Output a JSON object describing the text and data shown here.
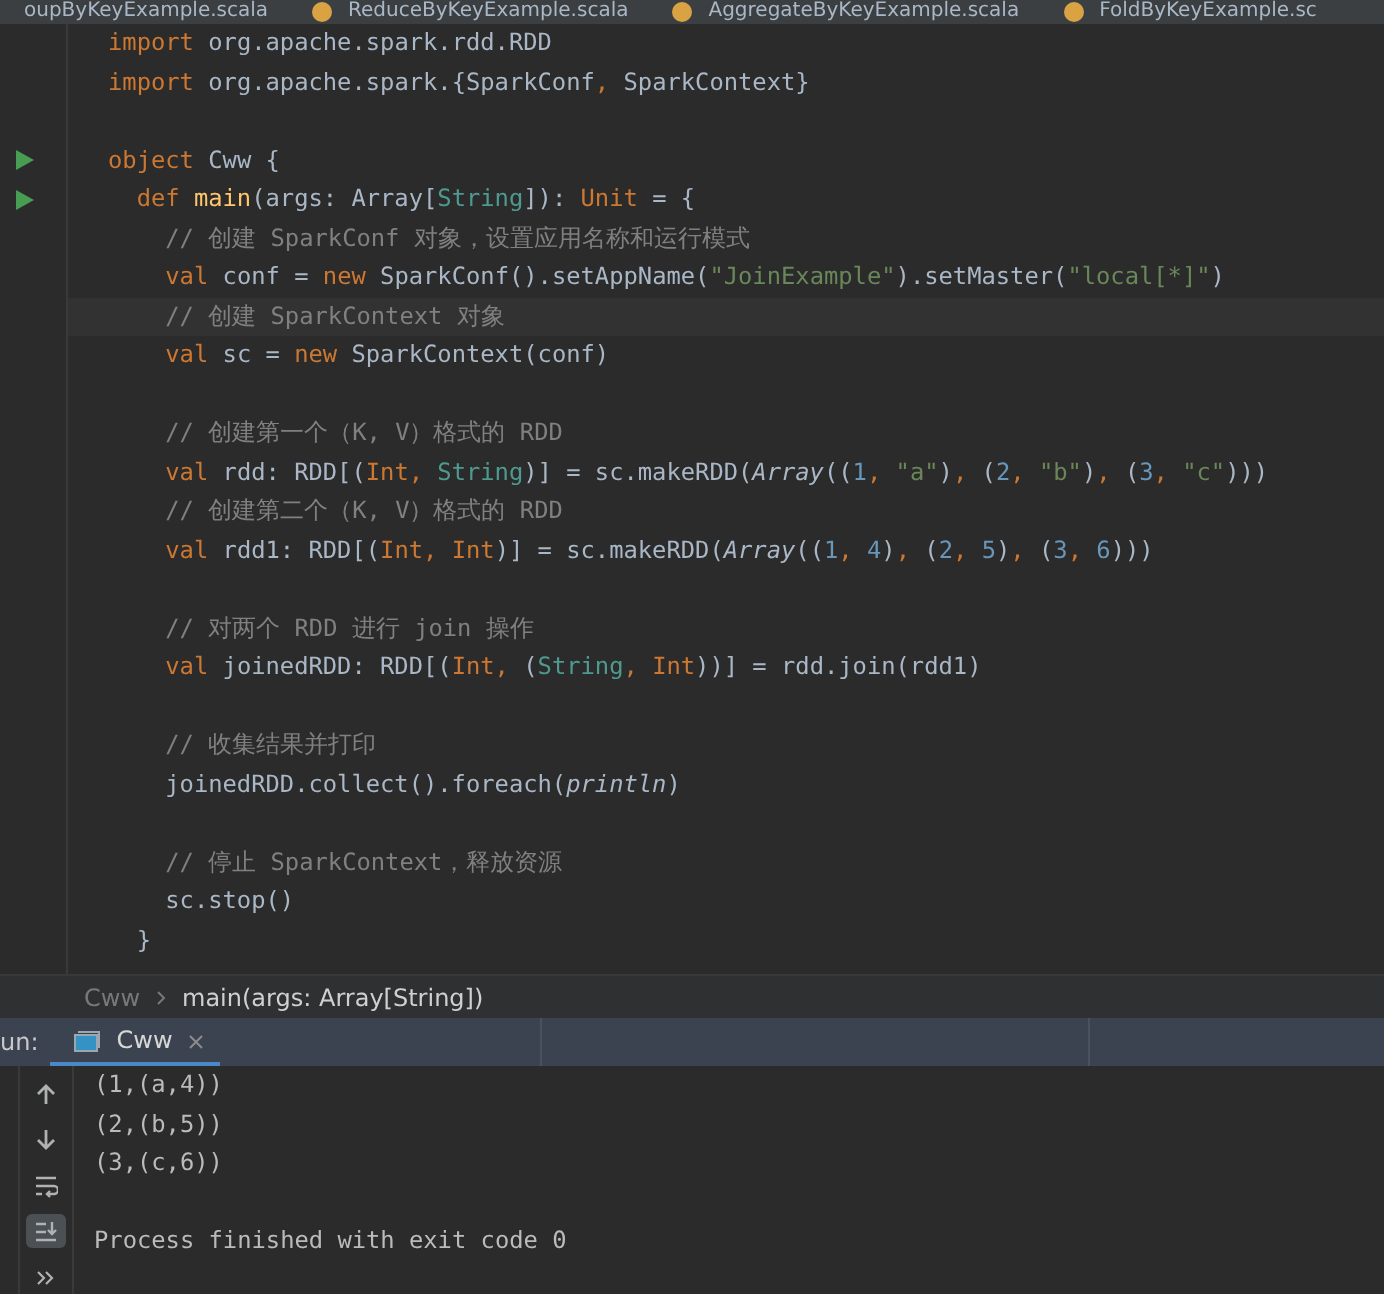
{
  "editor_tabs": [
    {
      "label": "oupByKeyExample.scala",
      "icon": false
    },
    {
      "label": "ReduceByKeyExample.scala",
      "icon": true
    },
    {
      "label": "AggregateByKeyExample.scala",
      "icon": true
    },
    {
      "label": "FoldByKeyExample.sc",
      "icon": true
    }
  ],
  "code_lines": [
    {
      "kind": "code",
      "tokens": [
        {
          "t": "import ",
          "kind": "kw"
        },
        {
          "t": "org.apache.spark.rdd.RDD",
          "kind": "id"
        }
      ]
    },
    {
      "kind": "code",
      "tokens": [
        {
          "t": "import ",
          "kind": "kw"
        },
        {
          "t": "org.apache.spark.{SparkConf",
          "kind": "id"
        },
        {
          "t": ", ",
          "kind": "kw"
        },
        {
          "t": "SparkContext}",
          "kind": "id"
        }
      ]
    },
    {
      "kind": "blank"
    },
    {
      "kind": "code",
      "run": true,
      "tokens": [
        {
          "t": "object ",
          "kind": "kw"
        },
        {
          "t": "Cww {",
          "kind": "id"
        }
      ]
    },
    {
      "kind": "code",
      "run": true,
      "tokens": [
        {
          "t": "  def ",
          "kind": "kw"
        },
        {
          "t": "main",
          "kind": "fn"
        },
        {
          "t": "(args: Array[",
          "kind": "id"
        },
        {
          "t": "String",
          "kind": "type"
        },
        {
          "t": "]): ",
          "kind": "id"
        },
        {
          "t": "Unit",
          "kind": "kw"
        },
        {
          "t": " = {",
          "kind": "id"
        }
      ]
    },
    {
      "kind": "code",
      "tokens": [
        {
          "t": "    // 创建 SparkConf 对象，设置应用名称和运行模式",
          "kind": "cmt"
        }
      ]
    },
    {
      "kind": "code",
      "tokens": [
        {
          "t": "    val ",
          "kind": "kw"
        },
        {
          "t": "conf = ",
          "kind": "id"
        },
        {
          "t": "new ",
          "kind": "kw"
        },
        {
          "t": "SparkConf().setAppName(",
          "kind": "id"
        },
        {
          "t": "\"JoinExample\"",
          "kind": "str"
        },
        {
          "t": ").setMaster(",
          "kind": "id"
        },
        {
          "t": "\"local[*]\"",
          "kind": "str"
        },
        {
          "t": ")",
          "kind": "id"
        }
      ]
    },
    {
      "kind": "code",
      "current": true,
      "tokens": [
        {
          "t": "    // 创建 SparkContext 对象",
          "kind": "cmt"
        }
      ]
    },
    {
      "kind": "code",
      "tokens": [
        {
          "t": "    val ",
          "kind": "kw"
        },
        {
          "t": "sc = ",
          "kind": "id"
        },
        {
          "t": "new ",
          "kind": "kw"
        },
        {
          "t": "SparkContext(conf)",
          "kind": "id"
        }
      ]
    },
    {
      "kind": "blank"
    },
    {
      "kind": "code",
      "tokens": [
        {
          "t": "    // 创建第一个（K, V）格式的 RDD",
          "kind": "cmt"
        }
      ]
    },
    {
      "kind": "code",
      "tokens": [
        {
          "t": "    val ",
          "kind": "kw"
        },
        {
          "t": "rdd: RDD[(",
          "kind": "id"
        },
        {
          "t": "Int, ",
          "kind": "kw"
        },
        {
          "t": "String",
          "kind": "type"
        },
        {
          "t": ")] = sc.makeRDD(",
          "kind": "id"
        },
        {
          "t": "Array",
          "kind": "ital"
        },
        {
          "t": "((",
          "kind": "id"
        },
        {
          "t": "1",
          "kind": "num"
        },
        {
          "t": ", ",
          "kind": "kw"
        },
        {
          "t": "\"a\"",
          "kind": "str"
        },
        {
          "t": ")",
          "kind": "id"
        },
        {
          "t": ", ",
          "kind": "kw"
        },
        {
          "t": "(",
          "kind": "id"
        },
        {
          "t": "2",
          "kind": "num"
        },
        {
          "t": ", ",
          "kind": "kw"
        },
        {
          "t": "\"b\"",
          "kind": "str"
        },
        {
          "t": ")",
          "kind": "id"
        },
        {
          "t": ", ",
          "kind": "kw"
        },
        {
          "t": "(",
          "kind": "id"
        },
        {
          "t": "3",
          "kind": "num"
        },
        {
          "t": ", ",
          "kind": "kw"
        },
        {
          "t": "\"c\"",
          "kind": "str"
        },
        {
          "t": ")))",
          "kind": "id"
        }
      ]
    },
    {
      "kind": "code",
      "tokens": [
        {
          "t": "    // 创建第二个（K, V）格式的 RDD",
          "kind": "cmt"
        }
      ]
    },
    {
      "kind": "code",
      "tokens": [
        {
          "t": "    val ",
          "kind": "kw"
        },
        {
          "t": "rdd1: RDD[(",
          "kind": "id"
        },
        {
          "t": "Int, Int",
          "kind": "kw"
        },
        {
          "t": ")] = sc.makeRDD(",
          "kind": "id"
        },
        {
          "t": "Array",
          "kind": "ital"
        },
        {
          "t": "((",
          "kind": "id"
        },
        {
          "t": "1",
          "kind": "num"
        },
        {
          "t": ", ",
          "kind": "kw"
        },
        {
          "t": "4",
          "kind": "num"
        },
        {
          "t": ")",
          "kind": "id"
        },
        {
          "t": ", ",
          "kind": "kw"
        },
        {
          "t": "(",
          "kind": "id"
        },
        {
          "t": "2",
          "kind": "num"
        },
        {
          "t": ", ",
          "kind": "kw"
        },
        {
          "t": "5",
          "kind": "num"
        },
        {
          "t": ")",
          "kind": "id"
        },
        {
          "t": ", ",
          "kind": "kw"
        },
        {
          "t": "(",
          "kind": "id"
        },
        {
          "t": "3",
          "kind": "num"
        },
        {
          "t": ", ",
          "kind": "kw"
        },
        {
          "t": "6",
          "kind": "num"
        },
        {
          "t": ")))",
          "kind": "id"
        }
      ]
    },
    {
      "kind": "blank"
    },
    {
      "kind": "code",
      "tokens": [
        {
          "t": "    // 对两个 RDD 进行 join 操作",
          "kind": "cmt"
        }
      ]
    },
    {
      "kind": "code",
      "tokens": [
        {
          "t": "    val ",
          "kind": "kw"
        },
        {
          "t": "joinedRDD: RDD[(",
          "kind": "id"
        },
        {
          "t": "Int, ",
          "kind": "kw"
        },
        {
          "t": "(",
          "kind": "id"
        },
        {
          "t": "String",
          "kind": "type"
        },
        {
          "t": ", Int",
          "kind": "kw"
        },
        {
          "t": "))] = rdd.join(rdd1)",
          "kind": "id"
        }
      ]
    },
    {
      "kind": "blank"
    },
    {
      "kind": "code",
      "tokens": [
        {
          "t": "    // 收集结果并打印",
          "kind": "cmt"
        }
      ]
    },
    {
      "kind": "code",
      "tokens": [
        {
          "t": "    joinedRDD.collect().foreach(",
          "kind": "id"
        },
        {
          "t": "println",
          "kind": "ital"
        },
        {
          "t": ")",
          "kind": "id"
        }
      ]
    },
    {
      "kind": "blank"
    },
    {
      "kind": "code",
      "tokens": [
        {
          "t": "    // 停止 SparkContext，释放资源",
          "kind": "cmt"
        }
      ]
    },
    {
      "kind": "code",
      "tokens": [
        {
          "t": "    sc.stop()",
          "kind": "id"
        }
      ]
    },
    {
      "kind": "code",
      "tokens": [
        {
          "t": "  }",
          "kind": "id"
        }
      ]
    }
  ],
  "breadcrumbs": [
    "Cww",
    "main(args: Array[String])"
  ],
  "run_panel": {
    "label": "un:",
    "tabs": [
      {
        "label": "Cww",
        "selected": true
      }
    ],
    "output": [
      "(1,(a,4))",
      "(2,(b,5))",
      "(3,(c,6))"
    ],
    "exit_message": "Process finished with exit code 0"
  }
}
